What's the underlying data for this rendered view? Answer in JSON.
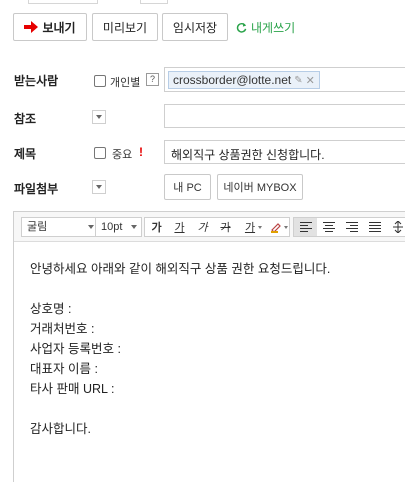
{
  "toolbar": {
    "send_label": "보내기",
    "preview_label": "미리보기",
    "save_draft_label": "임시저장",
    "self_mail_label": "내게쓰기"
  },
  "form": {
    "to": {
      "label": "받는사람",
      "individual_label": "개인별",
      "help": "?",
      "recipient": "crossborder@lotte.net"
    },
    "cc": {
      "label": "참조",
      "value": ""
    },
    "subject": {
      "label": "제목",
      "important_label": "중요",
      "important_mark": "!",
      "value": "해외직구 상품권한 신청합니다."
    },
    "attach": {
      "label": "파일첨부",
      "my_pc_label": "내 PC",
      "mybox_label": "네이버 MYBOX"
    }
  },
  "editor": {
    "font_family": "굴림",
    "font_size": "10pt",
    "format_buttons": {
      "bold": "가",
      "underline": "가",
      "italic": "가",
      "strike": "가",
      "color": "가"
    },
    "body_lines": [
      "안녕하세요 아래와 같이 해외직구 상품 권한 요청드립니다.",
      "",
      "상호명 :",
      "거래처번호 :",
      "사업자 등록번호 :",
      "대표자 이름 :",
      "타사 판매 URL :",
      "",
      "감사합니다."
    ]
  },
  "colors": {
    "accent_red": "#e60000",
    "self_mail_green": "#2aa34a",
    "chip_bg": "#eaf1f9"
  }
}
